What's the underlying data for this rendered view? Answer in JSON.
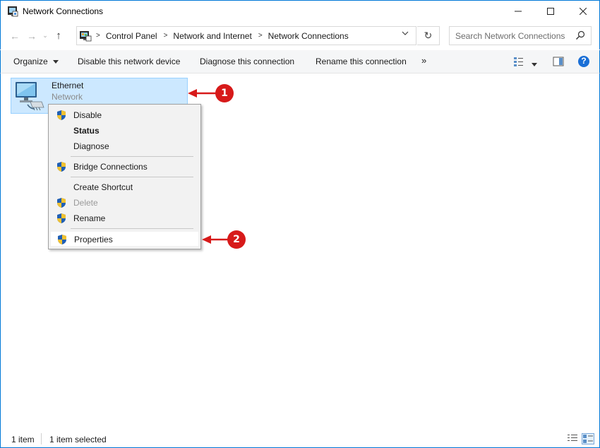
{
  "window": {
    "title": "Network Connections",
    "minimize_glyph": "—",
    "maximize_glyph": "☐",
    "close_glyph": "✕"
  },
  "nav": {
    "back_glyph": "←",
    "forward_glyph": "→",
    "recent_glyph": "⌄",
    "up_glyph": "↑",
    "breadcrumbs": [
      "Control Panel",
      "Network and Internet",
      "Network Connections"
    ],
    "breadcrumb_separator": ">",
    "dropdown_glyph": "⌄",
    "refresh_glyph": "↻",
    "search_placeholder": "Search Network Connections"
  },
  "toolbar": {
    "organize": "Organize",
    "disable": "Disable this network device",
    "diagnose": "Diagnose this connection",
    "rename": "Rename this connection",
    "more": "»",
    "help": "?"
  },
  "item": {
    "name": "Ethernet",
    "status": "Network"
  },
  "context_menu": {
    "items": [
      {
        "label": "Disable",
        "shield": true,
        "bold": false,
        "disabled": false
      },
      {
        "label": "Status",
        "shield": false,
        "bold": true,
        "disabled": false
      },
      {
        "label": "Diagnose",
        "shield": false,
        "bold": false,
        "disabled": false
      },
      {
        "label": "Bridge Connections",
        "shield": true,
        "bold": false,
        "disabled": false
      },
      {
        "label": "Create Shortcut",
        "shield": false,
        "bold": false,
        "disabled": false
      },
      {
        "label": "Delete",
        "shield": true,
        "bold": false,
        "disabled": true
      },
      {
        "label": "Rename",
        "shield": true,
        "bold": false,
        "disabled": false
      },
      {
        "label": "Properties",
        "shield": true,
        "bold": false,
        "disabled": false,
        "highlighted": true
      }
    ]
  },
  "status_bar": {
    "count": "1 item",
    "selected": "1 item selected"
  },
  "annotations": {
    "step1": "1",
    "step2": "2"
  },
  "colors": {
    "accent": "#0078d7",
    "selection": "#cce8ff",
    "callout": "#d71a1a",
    "help": "#1a6fd6"
  }
}
